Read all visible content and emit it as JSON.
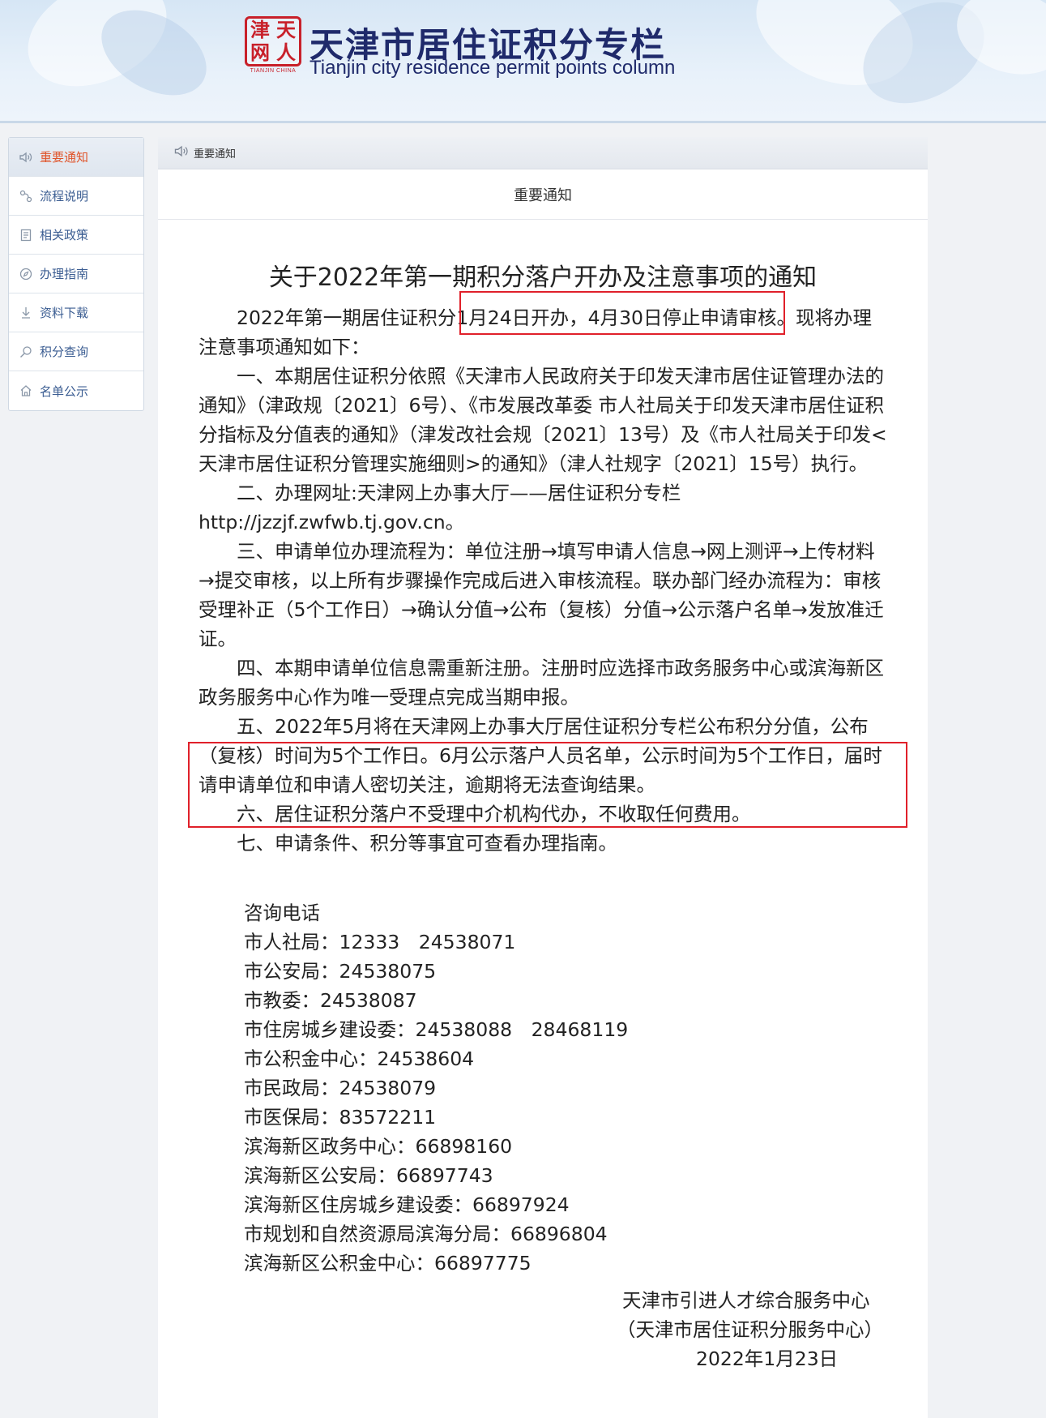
{
  "header": {
    "logo_chars": [
      "津",
      "天",
      "网",
      "人"
    ],
    "logo_sub": "TIANJIN CHINA",
    "title": "天津市居住证积分专栏",
    "subtitle": "Tianjin city residence permit points column"
  },
  "sidebar": {
    "items": [
      {
        "label": "重要通知",
        "icon": "speaker-icon",
        "active": true
      },
      {
        "label": "流程说明",
        "icon": "flow-icon"
      },
      {
        "label": "相关政策",
        "icon": "document-icon"
      },
      {
        "label": "办理指南",
        "icon": "compass-icon"
      },
      {
        "label": "资料下载",
        "icon": "download-icon"
      },
      {
        "label": "积分查询",
        "icon": "search-icon"
      },
      {
        "label": "名单公示",
        "icon": "home-icon"
      }
    ]
  },
  "main": {
    "breadcrumb": "重要通知",
    "section_title": "重要通知",
    "doc_title": "关于2022年第一期积分落户开办及注意事项的通知",
    "paragraphs": [
      "2022年第一期居住证积分1月24日开办，4月30日停止申请审核。现将办理注意事项通知如下：",
      "一、本期居住证积分依照《天津市人民政府关于印发天津市居住证管理办法的通知》（津政规〔2021〕6号）、《市发展改革委 市人社局关于印发天津市居住证积分指标及分值表的通知》（津发改社会规〔2021〕13号）及《市人社局关于印发<天津市居住证积分管理实施细则>的通知》（津人社规字〔2021〕15号）执行。",
      "二、办理网址:天津网上办事大厅——居住证积分专栏http://jzzjf.zwfwb.tj.gov.cn。",
      "三、申请单位办理流程为：单位注册→填写申请人信息→网上测评→上传材料→提交审核，以上所有步骤操作完成后进入审核流程。联办部门经办流程为：审核受理补正（5个工作日）→确认分值→公布（复核）分值→公示落户名单→发放准迁证。",
      "四、本期申请单位信息需重新注册。注册时应选择市政务服务中心或滨海新区政务服务中心作为唯一受理点完成当期申报。",
      "五、2022年5月将在天津网上办事大厅居住证积分专栏公布积分分值，公布（复核）时间为5个工作日。6月公示落户人员名单，公示时间为5个工作日，届时请申请单位和申请人密切关注，逾期将无法查询结果。",
      "六、居住证积分落户不受理中介机构代办，不收取任何费用。",
      "七、申请条件、积分等事宜可查看办理指南。"
    ],
    "contacts_title": "咨询电话",
    "contacts": [
      "市人社局：12333　24538071",
      "市公安局：24538075",
      "市教委：24538087",
      "市住房城乡建设委：24538088　28468119",
      "市公积金中心：24538604",
      "市民政局：24538079",
      "市医保局：83572211",
      "滨海新区政务中心：66898160",
      "滨海新区公安局：66897743",
      "滨海新区住房城乡建设委：66897924",
      "市规划和自然资源局滨海分局：66896804",
      "滨海新区公积金中心：66897775"
    ],
    "signature": {
      "org": "天津市引进人才综合服务中心",
      "org_alt": "（天津市居住证积分服务中心）",
      "date": "2022年1月23日"
    },
    "highlight_color": "#e0202a"
  }
}
